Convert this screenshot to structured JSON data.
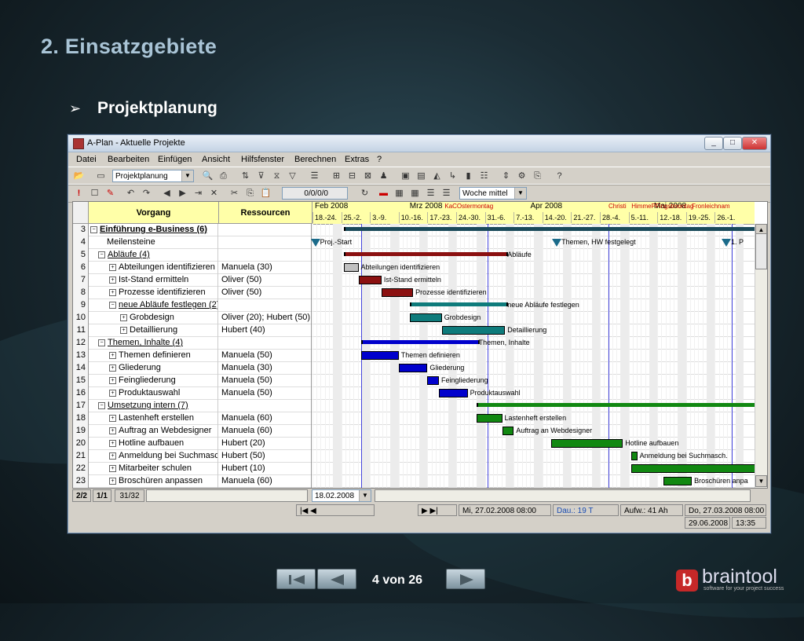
{
  "slide": {
    "title": "2. Einsatzgebiete",
    "bullet_symbol": "➢",
    "bullet_text": "Projektplanung"
  },
  "window": {
    "title": "A-Plan - Aktuelle Projekte",
    "controls": [
      "_",
      "□",
      "✕"
    ]
  },
  "menu": [
    "Datei",
    "Bearbeiten",
    "Einfügen",
    "Ansicht",
    "Hilfsfenster",
    "Berechnen",
    "Extras",
    "?"
  ],
  "toolbar": {
    "view_select": "Projektplanung",
    "counter": "0/0/0/0",
    "zoom_select": "Woche mittel"
  },
  "columns": {
    "task": "Vorgang",
    "resources": "Ressourcen"
  },
  "months": [
    "Feb 2008",
    "Mrz 2008",
    "Apr 2008",
    "Mai 2008"
  ],
  "weeks": [
    "18.-24.",
    "25.-2.",
    "3.-9.",
    "10.-16.",
    "17.-23.",
    "24.-30.",
    "31.-6.",
    "7.-13.",
    "14.-20.",
    "21.-27.",
    "28.-4.",
    "5.-11.",
    "12.-18.",
    "19.-25.",
    "26.-1."
  ],
  "holidays": [
    "KaCOstermontag",
    "Christi",
    "HimmePFingstmontag",
    "Fronleichnam"
  ],
  "rows": [
    {
      "n": "3",
      "task": "Einführung e-Business (6)",
      "res": "",
      "indent": 0,
      "exp": "−",
      "summary": true,
      "bold": true
    },
    {
      "n": "4",
      "task": "Meilensteine",
      "res": "",
      "indent": 1,
      "exp": "",
      "summary": false,
      "bold": false
    },
    {
      "n": "5",
      "task": "Abläufe (4)",
      "res": "",
      "indent": 1,
      "exp": "−",
      "summary": true,
      "bold": false
    },
    {
      "n": "6",
      "task": "Abteilungen identifizieren",
      "res": "Manuela (30)",
      "indent": 2,
      "exp": "+",
      "summary": false,
      "bold": false
    },
    {
      "n": "7",
      "task": "Ist-Stand ermitteln",
      "res": "Oliver (50)",
      "indent": 2,
      "exp": "+",
      "summary": false,
      "bold": false
    },
    {
      "n": "8",
      "task": "Prozesse identifizieren",
      "res": "Oliver (50)",
      "indent": 2,
      "exp": "+",
      "summary": false,
      "bold": false
    },
    {
      "n": "9",
      "task": "neue Abläufe festlegen (2)",
      "res": "",
      "indent": 2,
      "exp": "−",
      "summary": true,
      "bold": false
    },
    {
      "n": "10",
      "task": "Grobdesign",
      "res": "Oliver (20); Hubert (50)",
      "indent": 3,
      "exp": "+",
      "summary": false,
      "bold": false
    },
    {
      "n": "11",
      "task": "Detaillierung",
      "res": "Hubert (40)",
      "indent": 3,
      "exp": "+",
      "summary": false,
      "bold": false
    },
    {
      "n": "12",
      "task": "Themen, Inhalte (4)",
      "res": "",
      "indent": 1,
      "exp": "−",
      "summary": true,
      "bold": false
    },
    {
      "n": "13",
      "task": "Themen definieren",
      "res": "Manuela (50)",
      "indent": 2,
      "exp": "+",
      "summary": false,
      "bold": false
    },
    {
      "n": "14",
      "task": "Gliederung",
      "res": "Manuela (30)",
      "indent": 2,
      "exp": "+",
      "summary": false,
      "bold": false
    },
    {
      "n": "15",
      "task": "Feingliederung",
      "res": "Manuela (50)",
      "indent": 2,
      "exp": "+",
      "summary": false,
      "bold": false
    },
    {
      "n": "16",
      "task": "Produktauswahl",
      "res": "Manuela (50)",
      "indent": 2,
      "exp": "+",
      "summary": false,
      "bold": false
    },
    {
      "n": "17",
      "task": "Umsetzung intern (7)",
      "res": "",
      "indent": 1,
      "exp": "−",
      "summary": true,
      "bold": false
    },
    {
      "n": "18",
      "task": "Lastenheft erstellen",
      "res": "Manuela (60)",
      "indent": 2,
      "exp": "+",
      "summary": false,
      "bold": false
    },
    {
      "n": "19",
      "task": "Auftrag an Webdesigner",
      "res": "Manuela (60)",
      "indent": 2,
      "exp": "+",
      "summary": false,
      "bold": false
    },
    {
      "n": "20",
      "task": "Hotline aufbauen",
      "res": "Hubert (20)",
      "indent": 2,
      "exp": "+",
      "summary": false,
      "bold": false
    },
    {
      "n": "21",
      "task": "Anmeldung bei Suchmasc",
      "res": "Hubert (50)",
      "indent": 2,
      "exp": "+",
      "summary": false,
      "bold": false
    },
    {
      "n": "22",
      "task": "Mitarbeiter schulen",
      "res": "Hubert (10)",
      "indent": 2,
      "exp": "+",
      "summary": false,
      "bold": false
    },
    {
      "n": "23",
      "task": "Broschüren anpassen",
      "res": "Manuela (60)",
      "indent": 2,
      "exp": "+",
      "summary": false,
      "bold": false
    }
  ],
  "gantt": {
    "colors": {
      "dark_red": "#8b1010",
      "teal": "#0e7b7b",
      "blue": "#0000cc",
      "green": "#118811",
      "gray": "#c0c0c0",
      "summary": "#1a4a5a"
    },
    "summaries": [
      {
        "row": 0,
        "start": 1.1,
        "end": 15.5,
        "color": "summary",
        "label": ""
      },
      {
        "row": 2,
        "start": 1.1,
        "end": 6.7,
        "color": "dark_red",
        "label": "Abläufe"
      },
      {
        "row": 6,
        "start": 3.4,
        "end": 6.7,
        "color": "teal",
        "label": "neue Abläufe festlegen"
      },
      {
        "row": 9,
        "start": 1.7,
        "end": 5.7,
        "color": "blue",
        "label": "Themen, Inhalte"
      },
      {
        "row": 14,
        "start": 5.7,
        "end": 15.5,
        "color": "green",
        "label": ""
      }
    ],
    "bars": [
      {
        "row": 3,
        "start": 1.1,
        "end": 1.6,
        "color": "gray",
        "label": "Abteilungen identifizieren"
      },
      {
        "row": 4,
        "start": 1.6,
        "end": 2.4,
        "color": "dark_red",
        "label": "Ist-Stand ermitteln"
      },
      {
        "row": 5,
        "start": 2.4,
        "end": 3.5,
        "color": "dark_red",
        "label": "Prozesse identifizieren"
      },
      {
        "row": 7,
        "start": 3.4,
        "end": 4.5,
        "color": "teal",
        "label": "Grobdesign"
      },
      {
        "row": 8,
        "start": 4.5,
        "end": 6.7,
        "color": "teal",
        "label": "Detaillierung"
      },
      {
        "row": 10,
        "start": 1.7,
        "end": 3.0,
        "color": "blue",
        "label": "Themen definieren"
      },
      {
        "row": 11,
        "start": 3.0,
        "end": 4.0,
        "color": "blue",
        "label": "Gliederung"
      },
      {
        "row": 12,
        "start": 4.0,
        "end": 4.4,
        "color": "blue",
        "label": "Feingliederung"
      },
      {
        "row": 13,
        "start": 4.4,
        "end": 5.4,
        "color": "blue",
        "label": "Produktauswahl"
      },
      {
        "row": 15,
        "start": 5.7,
        "end": 6.6,
        "color": "green",
        "label": "Lastenheft erstellen"
      },
      {
        "row": 16,
        "start": 6.6,
        "end": 7.0,
        "color": "green",
        "label": "Auftrag an Webdesigner"
      },
      {
        "row": 17,
        "start": 8.3,
        "end": 10.8,
        "color": "green",
        "label": "Hotline aufbauen"
      },
      {
        "row": 18,
        "start": 11.1,
        "end": 11.3,
        "color": "green",
        "label": "Anmeldung bei Suchmasch."
      },
      {
        "row": 19,
        "start": 11.1,
        "end": 15.5,
        "color": "green",
        "label": ""
      },
      {
        "row": 20,
        "start": 12.2,
        "end": 13.2,
        "color": "green",
        "label": "Broschüren anpa"
      }
    ],
    "milestones": [
      {
        "row": 1,
        "at": 0.1,
        "label": "Proj.-Start"
      },
      {
        "row": 1,
        "at": 8.5,
        "label": "Themen, HW festgelegt"
      },
      {
        "row": 1,
        "at": 14.4,
        "label": "1. P"
      }
    ]
  },
  "bottom": {
    "level": "2/2",
    "page": "1/1",
    "rows": "31/32",
    "date_select": "18.02.2008"
  },
  "status": {
    "start": "Mi, 27.02.2008 08:00",
    "duration": "Dau.: 19 T",
    "effort": "Aufw.: 41 Ah",
    "end": "Do, 27.03.2008 08:00",
    "date": "29.06.2008",
    "time": "13:35"
  },
  "nav": {
    "page_label": "4 von 26"
  },
  "logo": {
    "name": "braintool",
    "tagline": "software for your project success",
    "mark": "b"
  }
}
